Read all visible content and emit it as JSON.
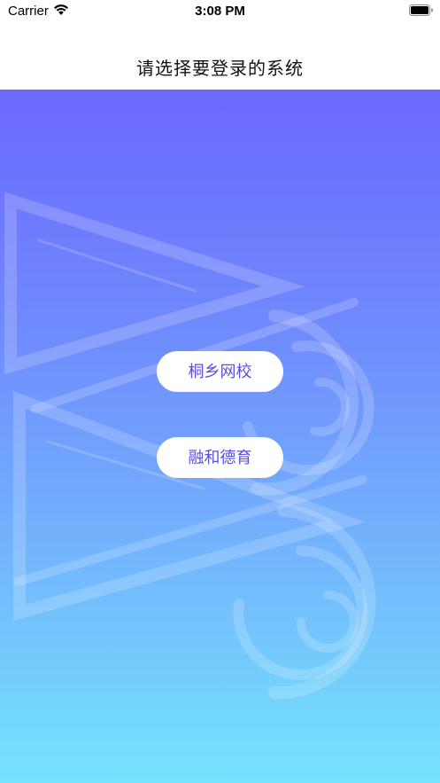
{
  "status_bar": {
    "carrier": "Carrier",
    "time": "3:08 PM",
    "wifi_icon": "wifi-icon",
    "battery_icon": "battery-icon"
  },
  "nav_bar": {
    "title": "请选择要登录的系统"
  },
  "systems": [
    {
      "label": "桐乡网校"
    },
    {
      "label": "融和德育"
    }
  ],
  "colors": {
    "gradient_top": "#6b68fe",
    "gradient_bottom": "#75e4fd",
    "button_text": "#5b4fe0",
    "button_bg": "#ffffff"
  },
  "background_icon": "play-camera-logo-watermark"
}
